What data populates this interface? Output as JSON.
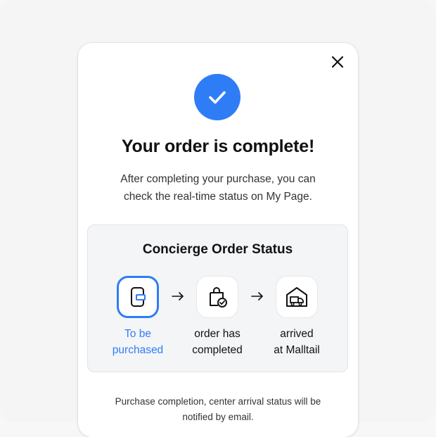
{
  "modal": {
    "title": "Your order is complete!",
    "subtitle_line1": "After completing your purchase, you can",
    "subtitle_line2": "check the real-time status on My Page.",
    "close_icon": "close-icon",
    "success_icon": "checkmark-icon"
  },
  "status": {
    "title": "Concierge Order Status",
    "steps": [
      {
        "line1": "To be",
        "line2": "purchased",
        "icon": "phone-card-icon",
        "active": true
      },
      {
        "line1": "order has",
        "line2": "completed",
        "icon": "shopping-bag-check-icon",
        "active": false
      },
      {
        "line1": "arrived",
        "line2": "at Malltail",
        "icon": "warehouse-truck-icon",
        "active": false
      }
    ]
  },
  "footer": {
    "line1": "Purchase completion, center arrival status will be",
    "line2": "notified by email."
  },
  "colors": {
    "accent": "#2f7df6",
    "background": "#f5f5f6",
    "box": "#f4f5f7"
  }
}
